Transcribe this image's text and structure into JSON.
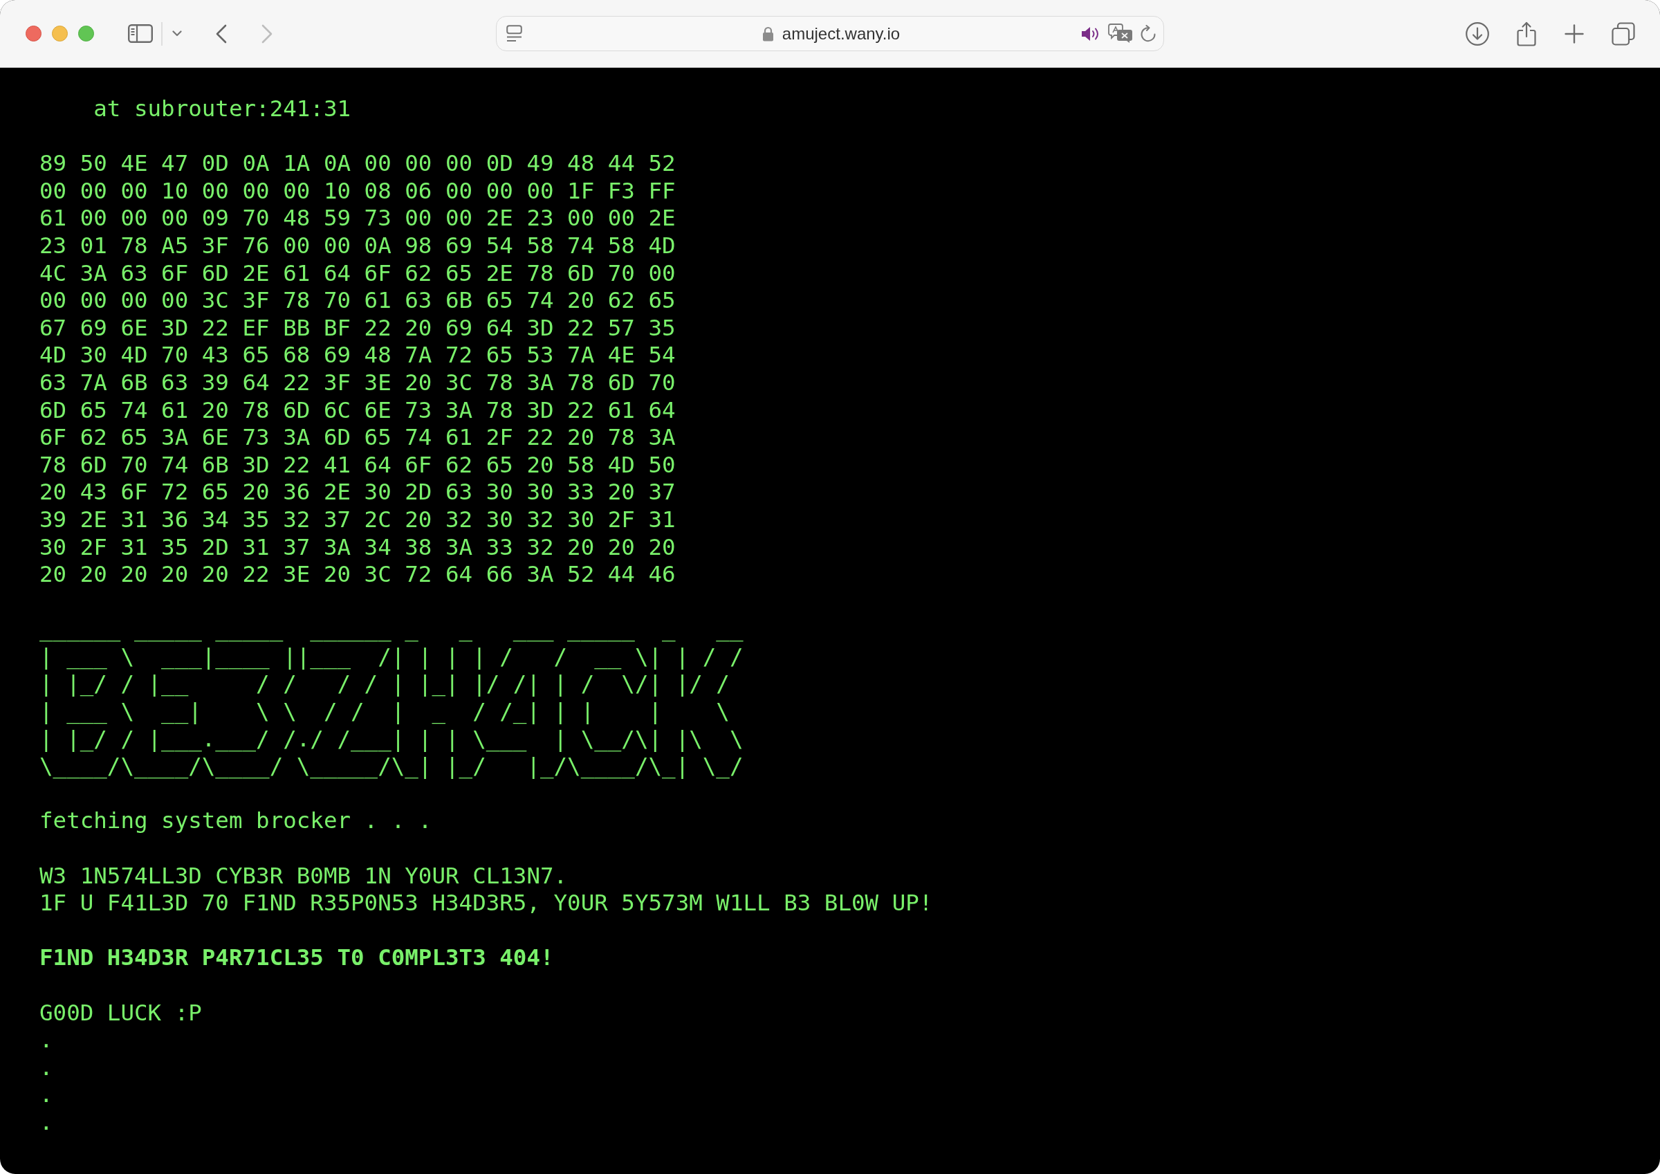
{
  "browser": {
    "back_button": {
      "disabled": false
    },
    "forward_button": {
      "disabled": true
    },
    "address_bar": {
      "url": "amuject.wany.io",
      "audio_playing": true
    }
  },
  "terminal": {
    "stack_trace": "at subrouter:241:31",
    "hex_dump": [
      "89 50 4E 47 0D 0A 1A 0A 00 00 00 0D 49 48 44 52",
      "00 00 00 10 00 00 00 10 08 06 00 00 00 1F F3 FF",
      "61 00 00 00 09 70 48 59 73 00 00 2E 23 00 00 2E",
      "23 01 78 A5 3F 76 00 00 0A 98 69 54 58 74 58 4D",
      "4C 3A 63 6F 6D 2E 61 64 6F 62 65 2E 78 6D 70 00",
      "00 00 00 00 3C 3F 78 70 61 63 6B 65 74 20 62 65",
      "67 69 6E 3D 22 EF BB BF 22 20 69 64 3D 22 57 35",
      "4D 30 4D 70 43 65 68 69 48 7A 72 65 53 7A 4E 54",
      "63 7A 6B 63 39 64 22 3F 3E 20 3C 78 3A 78 6D 70",
      "6D 65 74 61 20 78 6D 6C 6E 73 3A 78 3D 22 61 64",
      "6F 62 65 3A 6E 73 3A 6D 65 74 61 2F 22 20 78 3A",
      "78 6D 70 74 6B 3D 22 41 64 6F 62 65 20 58 4D 50",
      "20 43 6F 72 65 20 36 2E 30 2D 63 30 30 33 20 37",
      "39 2E 31 36 34 35 32 37 2C 20 32 30 32 30 2F 31",
      "30 2F 31 35 2D 31 37 3A 34 38 3A 33 32 20 20 20",
      "20 20 20 20 20 22 3E 20 3C 72 64 66 3A 52 44 46"
    ],
    "banner_art": [
      "______ _____ _____  ______ _   _   ___ _____  _   __",
      "| ___ \\  ___|____ ||___  /| | | | /   /  __ \\| | / /",
      "| |_/ / |__     / /   / / | |_| |/ /| | /  \\/| |/ /",
      "| ___ \\  __|    \\ \\  / /  |  _  / /_| | |    |    \\",
      "| |_/ / |___.___/ /./ /___| | | \\___  | \\__/\\| |\\  \\",
      "\\____/\\____/\\____/ \\_____/\\_| |_/   |_/\\____/\\_| \\_/"
    ],
    "status": "fetching system brocker . . .",
    "warning": [
      "W3 1N574LL3D CYB3R B0MB 1N Y0UR CL13N7.",
      "1F U F41L3D 70 F1ND R35P0N53 H34D3R5, Y0UR 5Y573M W1LL B3 BL0W UP!"
    ],
    "headline": "F1ND H34D3R P4R71CL35 T0 C0MPL3T3 404!",
    "signoff": "G00D LUCK :P",
    "trailing_dots": [
      ".",
      ".",
      ".",
      "."
    ]
  }
}
